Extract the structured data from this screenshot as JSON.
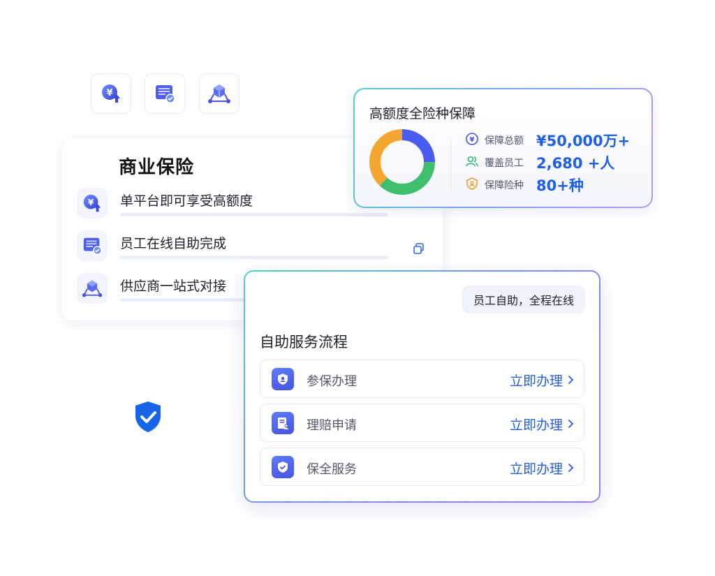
{
  "feature_icons": [
    "yuan-up-icon",
    "card-check-icon",
    "network-cube-icon"
  ],
  "business": {
    "title": "商业保险",
    "items": [
      {
        "label": "单平台即可享受高额度",
        "icon": "yuan-up-icon"
      },
      {
        "label": "员工在线自助完成",
        "icon": "card-check-icon"
      },
      {
        "label": "供应商一站式对接",
        "icon": "network-cube-icon"
      }
    ]
  },
  "coverage": {
    "title": "高额度全险种保障",
    "stats": [
      {
        "label": "保障总额",
        "value": "¥50,000万+",
        "icon": "yuan-circle-icon"
      },
      {
        "label": "覆盖员工",
        "value": "2,680 +人",
        "icon": "users-icon"
      },
      {
        "label": "保障险种",
        "value": "80+种",
        "icon": "shield-person-icon"
      }
    ],
    "donut": [
      {
        "fraction": 0.25,
        "color": "#4a5cf0"
      },
      {
        "fraction": 0.37,
        "color": "#3fbf6e"
      },
      {
        "fraction": 0.38,
        "color": "#f7a531"
      }
    ]
  },
  "service": {
    "badge": "员工自助，全程在线",
    "title": "自助服务流程",
    "rows": [
      {
        "label": "参保办理",
        "action": "立即办理",
        "icon": "shield-user-icon"
      },
      {
        "label": "理赔申请",
        "action": "立即办理",
        "icon": "claim-doc-icon"
      },
      {
        "label": "保全服务",
        "action": "立即办理",
        "icon": "shield-check-icon"
      }
    ]
  },
  "colors": {
    "accent": "#1f5fe6",
    "primary_icon": "#4a52e0",
    "shield": "#1565e6"
  }
}
